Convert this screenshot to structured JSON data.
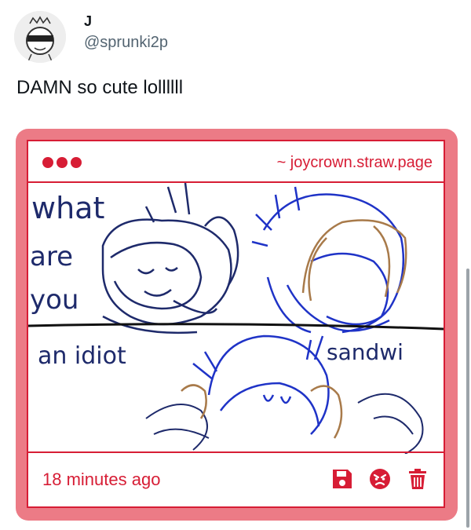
{
  "tweet": {
    "author": "J",
    "handle": "@sprunki2p",
    "text": "DAMN so cute lollllll"
  },
  "widget": {
    "url": "~ joycrown.straw.page",
    "timestamp": "18 minutes ago",
    "accent": "#d71d35",
    "frame": "#ec7b86",
    "drawing_text": {
      "what": "what",
      "are": "are",
      "you": "you",
      "idiot": "an idiot",
      "sandwich": "sandwi"
    },
    "footer_icons": [
      "save-icon",
      "angry-face-icon",
      "trash-icon"
    ]
  }
}
